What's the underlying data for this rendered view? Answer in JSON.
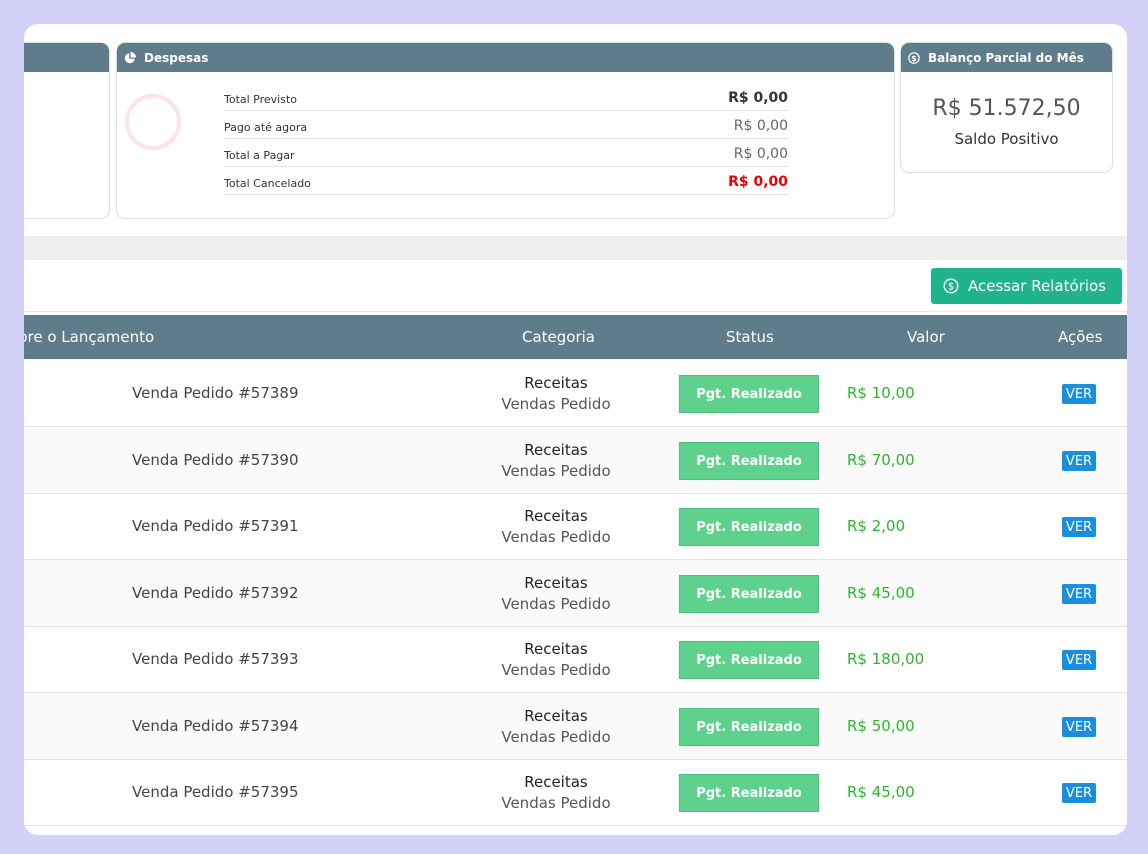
{
  "expenses_card": {
    "title": "Despesas",
    "rows": [
      {
        "label": "Total Previsto",
        "value": "R$ 0,00"
      },
      {
        "label": "Pago até agora",
        "value": "R$ 0,00"
      },
      {
        "label": "Total a Pagar",
        "value": "R$ 0,00"
      },
      {
        "label": "Total Cancelado",
        "value": "R$ 0,00"
      }
    ]
  },
  "balance_card": {
    "title": "Balanço Parcial do Mês",
    "value": "R$ 51.572,50",
    "status": "Saldo Positivo"
  },
  "toolbar": {
    "reports_label": "Acessar Relatórios"
  },
  "table": {
    "headers": [
      "bre o Lançamento",
      "Categoria",
      "Status",
      "Valor",
      "Ações"
    ],
    "rows": [
      {
        "name": "Venda Pedido #57389",
        "cat": "Receitas",
        "sub": "Vendas Pedido",
        "status": "Pgt. Realizado",
        "value": "R$ 10,00",
        "action": "VER"
      },
      {
        "name": "Venda Pedido #57390",
        "cat": "Receitas",
        "sub": "Vendas Pedido",
        "status": "Pgt. Realizado",
        "value": "R$ 70,00",
        "action": "VER"
      },
      {
        "name": "Venda Pedido #57391",
        "cat": "Receitas",
        "sub": "Vendas Pedido",
        "status": "Pgt. Realizado",
        "value": "R$ 2,00",
        "action": "VER"
      },
      {
        "name": "Venda Pedido #57392",
        "cat": "Receitas",
        "sub": "Vendas Pedido",
        "status": "Pgt. Realizado",
        "value": "R$ 45,00",
        "action": "VER"
      },
      {
        "name": "Venda Pedido #57393",
        "cat": "Receitas",
        "sub": "Vendas Pedido",
        "status": "Pgt. Realizado",
        "value": "R$ 180,00",
        "action": "VER"
      },
      {
        "name": "Venda Pedido #57394",
        "cat": "Receitas",
        "sub": "Vendas Pedido",
        "status": "Pgt. Realizado",
        "value": "R$ 50,00",
        "action": "VER"
      },
      {
        "name": "Venda Pedido #57395",
        "cat": "Receitas",
        "sub": "Vendas Pedido",
        "status": "Pgt. Realizado",
        "value": "R$ 45,00",
        "action": "VER"
      }
    ]
  },
  "colors": {
    "header_bg": "#5f7c8a",
    "status_green": "#5ed28c",
    "value_green": "#2db52d",
    "action_blue": "#1a8fe0",
    "reports_button": "#1fb48c",
    "cancel_red": "#e60000"
  }
}
